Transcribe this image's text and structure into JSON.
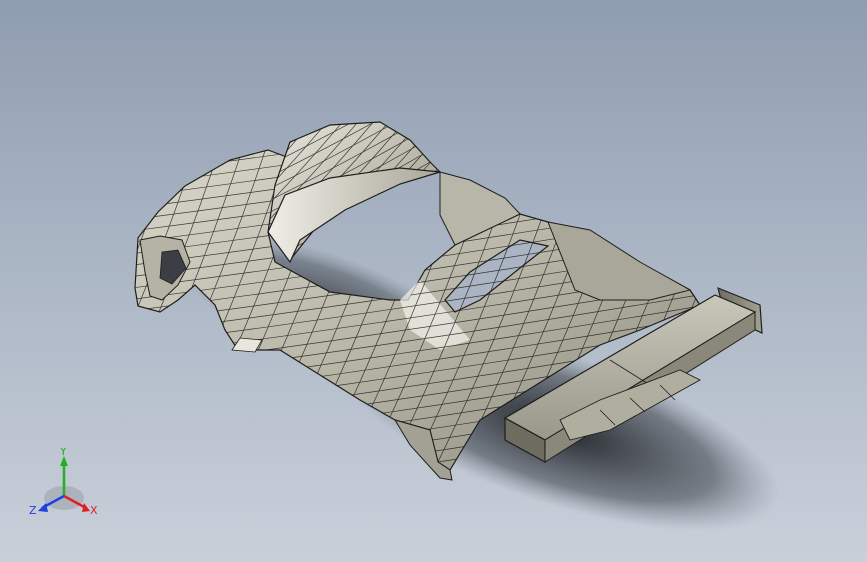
{
  "viewport": {
    "model": "car-body-surface",
    "display_style": "shaded-with-edges"
  },
  "triad": {
    "x_label": "X",
    "y_label": "Y",
    "z_label": "Z",
    "x_color": "#e02020",
    "y_color": "#20b020",
    "z_color": "#2040e0"
  },
  "colors": {
    "surface": "#c4c2b4",
    "surface_dark": "#7c7a6c",
    "highlight": "#f4f3ec",
    "edge": "#1e1e1c",
    "shadow": "#2a2e34"
  }
}
